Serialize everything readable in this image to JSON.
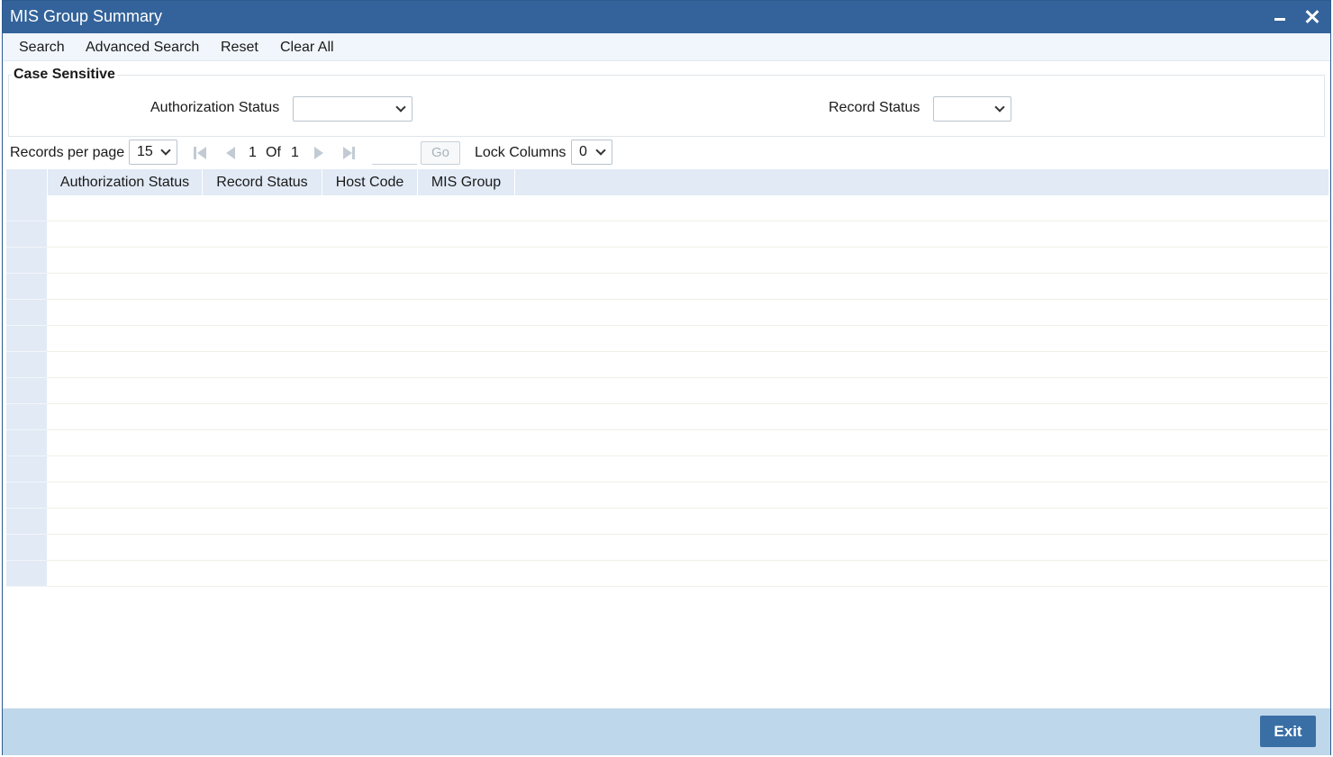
{
  "window": {
    "title": "MIS Group Summary"
  },
  "toolbar": {
    "search": "Search",
    "advanced_search": "Advanced Search",
    "reset": "Reset",
    "clear_all": "Clear All"
  },
  "criteria": {
    "legend": "Case Sensitive",
    "authorization_status_label": "Authorization Status",
    "authorization_status_value": "",
    "record_status_label": "Record Status",
    "record_status_value": ""
  },
  "pager": {
    "records_per_page_label": "Records per page",
    "records_per_page_value": "15",
    "current_page": "1",
    "of_label": "Of",
    "total_pages": "1",
    "go_label": "Go",
    "lock_columns_label": "Lock Columns",
    "lock_columns_value": "0"
  },
  "grid": {
    "columns": [
      "Authorization Status",
      "Record Status",
      "Host Code",
      "MIS Group"
    ],
    "row_count": 15
  },
  "footer": {
    "exit_label": "Exit"
  },
  "colors": {
    "title_bar": "#33639a",
    "toolbar_bg": "#f0f6fb",
    "grid_header": "#e1eaf5",
    "footer_bg": "#bfd7ea",
    "exit_button": "#3a6fa6"
  },
  "icons": [
    "minimize-icon",
    "close-icon",
    "first-page-icon",
    "prev-page-icon",
    "next-page-icon",
    "last-page-icon",
    "chevron-down-icon"
  ]
}
